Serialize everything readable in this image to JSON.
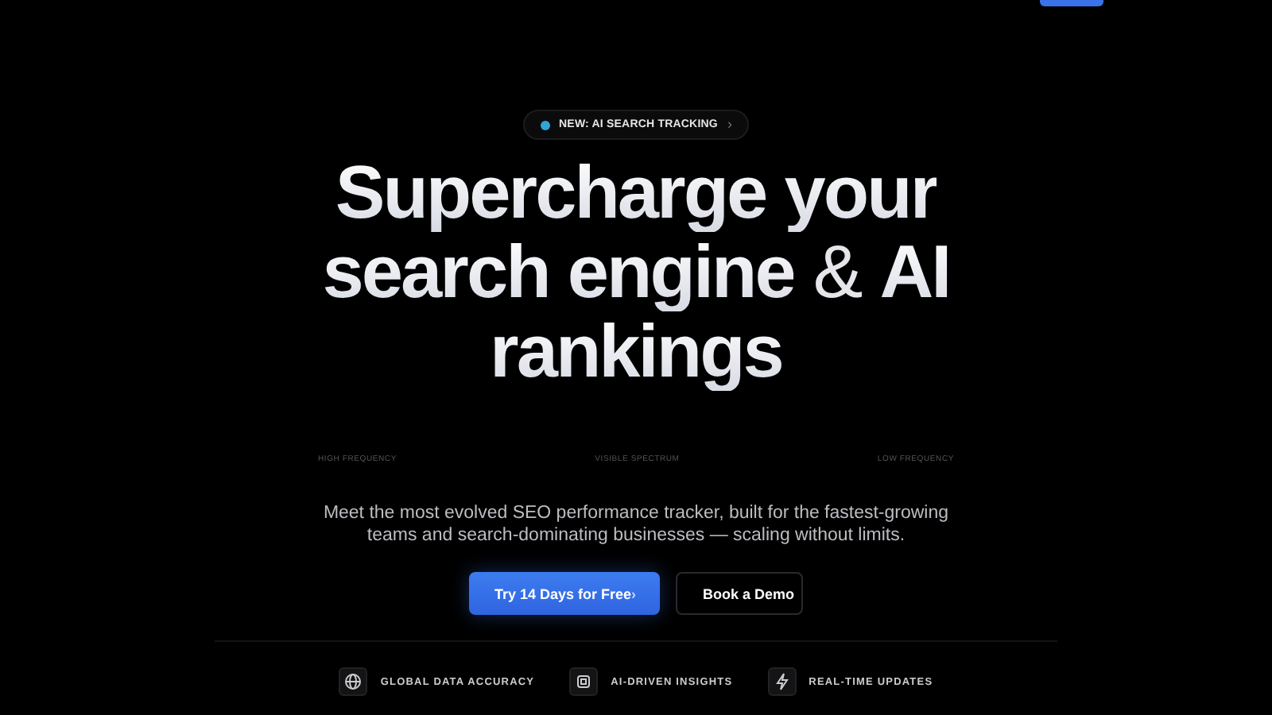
{
  "header": {
    "cta_button": {
      "kind": "primary"
    }
  },
  "announcement": {
    "label": "NEW: AI SEARCH TRACKING",
    "arrow": "›"
  },
  "headline": [
    [
      {
        "text": "Supercharge your",
        "kind": "strong"
      }
    ],
    [
      {
        "text": "search engine",
        "kind": "strong"
      },
      {
        "text": "&",
        "kind": "light"
      },
      {
        "text": "AI",
        "kind": "strong"
      }
    ],
    [
      {
        "text": "rankings",
        "kind": "strong"
      }
    ]
  ],
  "spectrum_labels": [
    "HIGH FREQUENCY",
    "VISIBLE SPECTRUM",
    "LOW FREQUENCY"
  ],
  "description": "Meet the most evolved SEO performance tracker, built for the fastest-growing teams and search-dominating businesses — scaling without limits.",
  "buttons": [
    {
      "label": "Try 14 Days for Free",
      "arrow": "›",
      "kind": "primary"
    },
    {
      "label": "Book a Demo",
      "kind": "secondary"
    }
  ],
  "features": [
    {
      "label": "GLOBAL DATA ACCURACY",
      "kind": "globe"
    },
    {
      "label": "AI-DRIVEN INSIGHTS",
      "kind": "chip"
    },
    {
      "label": "REAL-TIME UPDATES",
      "kind": "spark"
    }
  ]
}
